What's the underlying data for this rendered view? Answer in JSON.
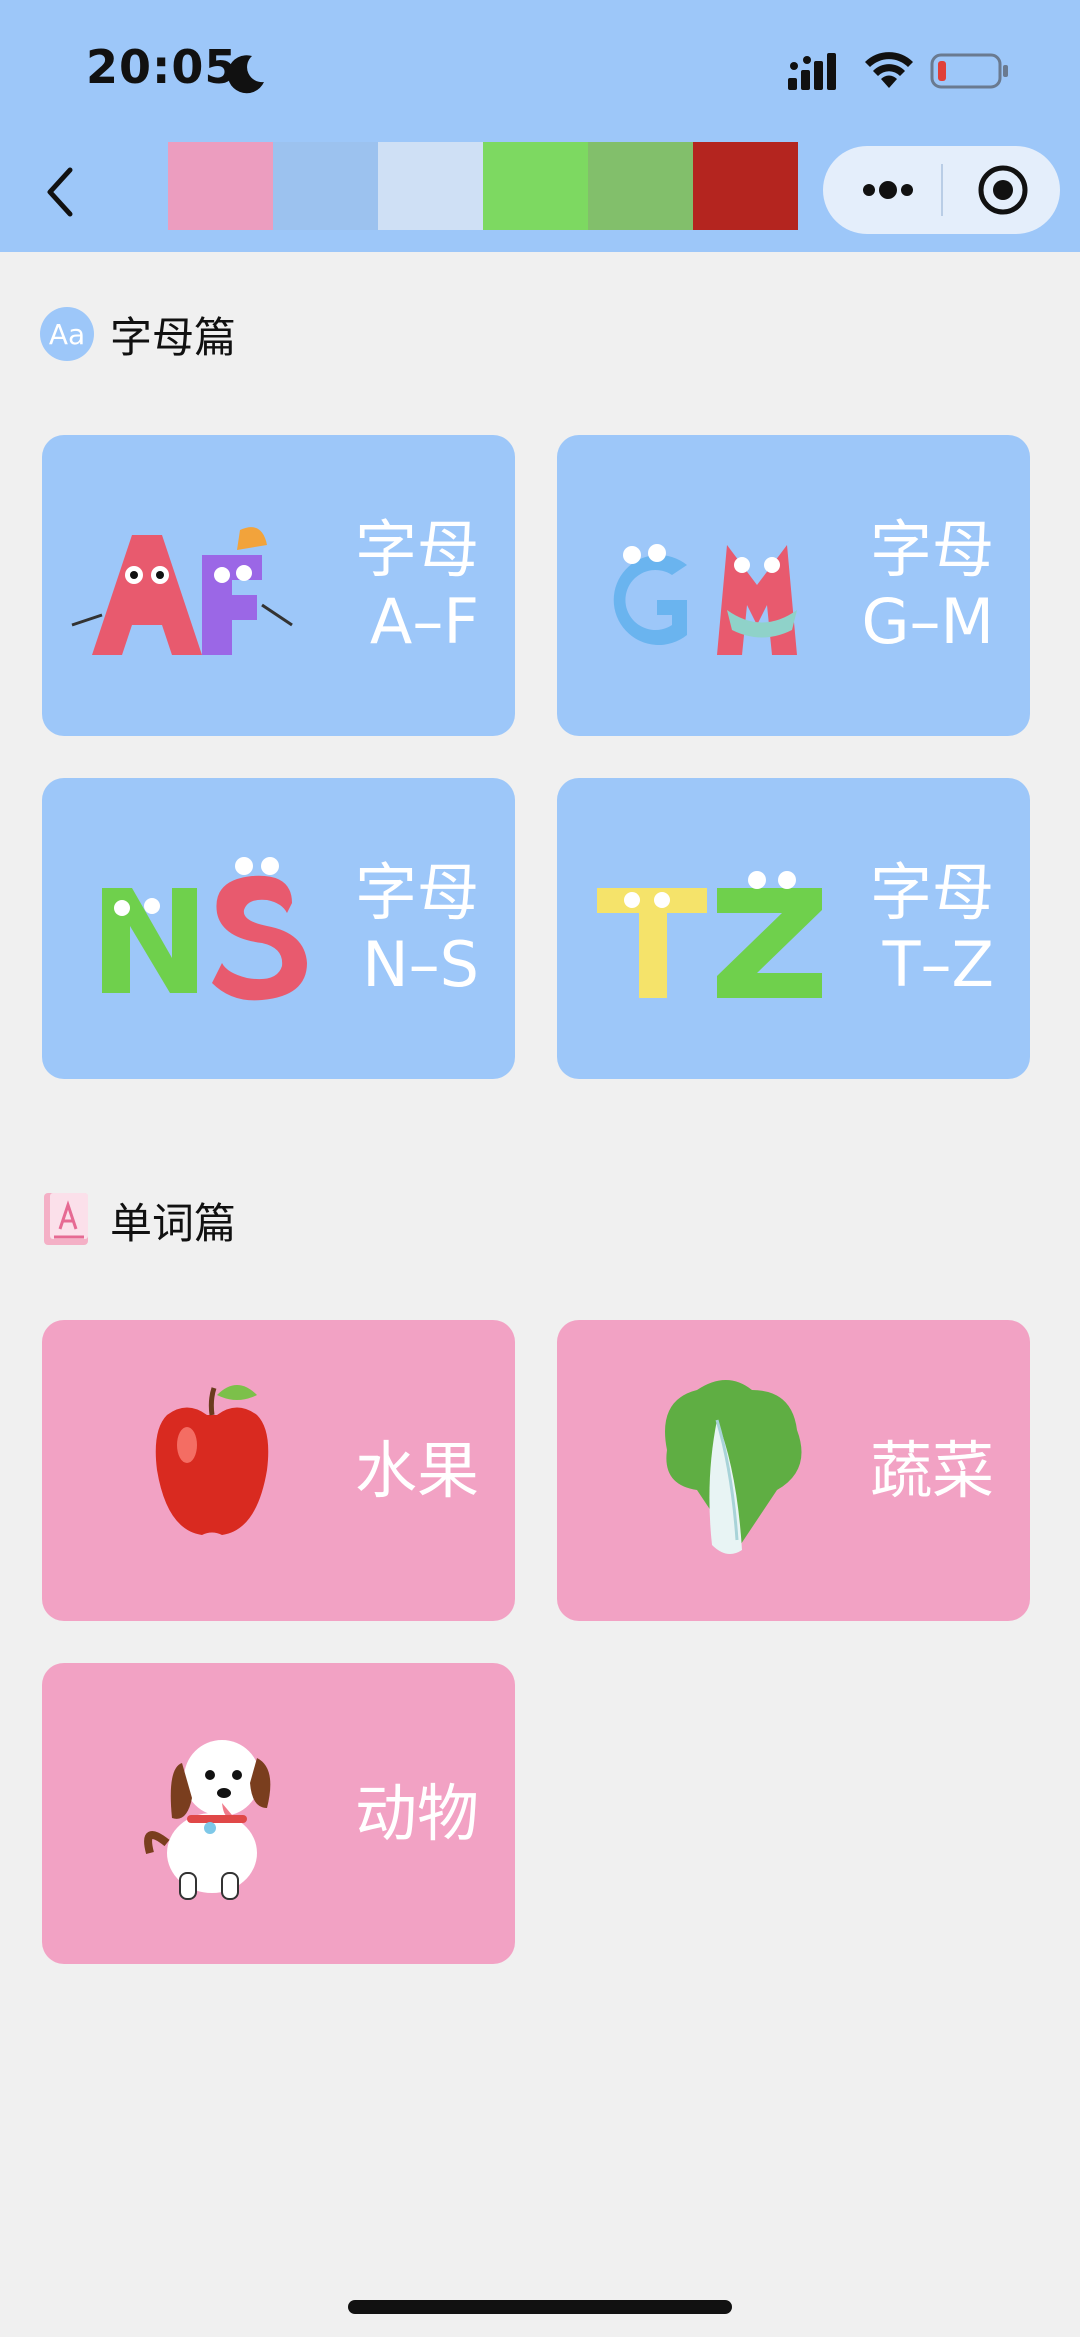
{
  "status_bar": {
    "time": "20:05"
  },
  "palette": {
    "colors": [
      "#ec9dbf",
      "#9cc2ef",
      "#cfe0f5",
      "#7dd961",
      "#82bf6b",
      "#b4251f"
    ]
  },
  "sections": {
    "letters": {
      "title": "字母篇",
      "icon_text": "Aa",
      "cards": [
        {
          "line1": "字母",
          "line2": "A–F"
        },
        {
          "line1": "字母",
          "line2": "G–M"
        },
        {
          "line1": "字母",
          "line2": "N–S"
        },
        {
          "line1": "字母",
          "line2": "T–Z"
        }
      ]
    },
    "words": {
      "title": "单词篇",
      "cards": [
        {
          "label": "水果"
        },
        {
          "label": "蔬菜"
        },
        {
          "label": "动物"
        }
      ]
    }
  },
  "colors": {
    "header_bg": "#9dc7f9",
    "letter_card": "#9dc7f9",
    "word_card": "#f2a2c4",
    "page_bg": "#f0f0f0"
  }
}
